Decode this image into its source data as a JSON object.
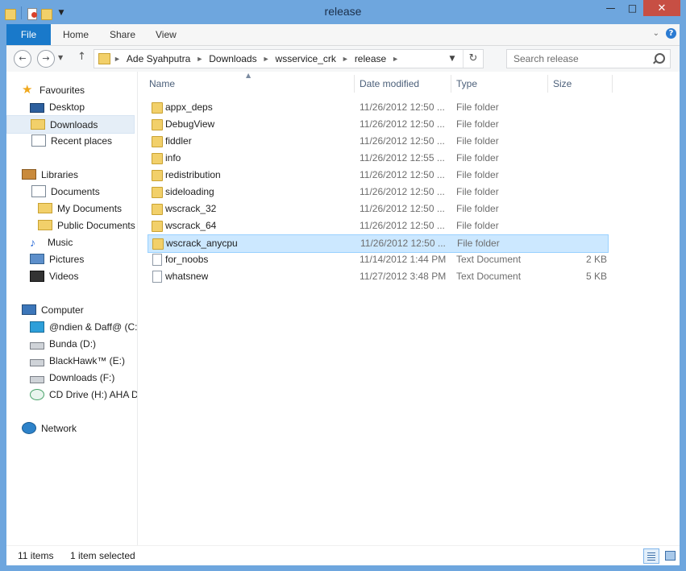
{
  "window": {
    "title": "release",
    "minimize": "—",
    "maximize": "□",
    "close": "✕"
  },
  "ribbon": {
    "tabs": [
      "File",
      "Home",
      "Share",
      "View"
    ]
  },
  "address": {
    "crumbs": [
      "Ade Syahputra",
      "Downloads",
      "wsservice_crk",
      "release"
    ]
  },
  "search": {
    "placeholder": "Search release"
  },
  "columns": {
    "name": "Name",
    "date": "Date modified",
    "type": "Type",
    "size": "Size"
  },
  "nav": [
    {
      "label": "Favourites",
      "icon": "star-icon",
      "indent": 0,
      "group": true
    },
    {
      "label": "Desktop",
      "icon": "desktop-icon",
      "indent": 1
    },
    {
      "label": "Downloads",
      "icon": "downloads-folder-icon",
      "indent": 1,
      "selected": true
    },
    {
      "label": "Recent places",
      "icon": "recent-places-icon",
      "indent": 1
    },
    {
      "label": "Libraries",
      "icon": "libraries-icon",
      "indent": 0,
      "group": true
    },
    {
      "label": "Documents",
      "icon": "documents-icon",
      "indent": 1
    },
    {
      "label": "My Documents",
      "icon": "folder-icon",
      "indent": 2
    },
    {
      "label": "Public Documents",
      "icon": "folder-icon",
      "indent": 2
    },
    {
      "label": "Music",
      "icon": "music-icon",
      "indent": 1
    },
    {
      "label": "Pictures",
      "icon": "pictures-icon",
      "indent": 1
    },
    {
      "label": "Videos",
      "icon": "videos-icon",
      "indent": 1
    },
    {
      "label": "Computer",
      "icon": "computer-icon",
      "indent": 0,
      "group": true
    },
    {
      "label": "@ndien & Daff@ (C:",
      "icon": "windows-drive-icon",
      "indent": 1
    },
    {
      "label": "Bunda (D:)",
      "icon": "drive-icon",
      "indent": 1
    },
    {
      "label": "BlackHawk™ (E:)",
      "icon": "drive-icon",
      "indent": 1
    },
    {
      "label": "Downloads (F:)",
      "icon": "drive-icon",
      "indent": 1
    },
    {
      "label": "CD Drive (H:) AHA D",
      "icon": "cd-drive-icon",
      "indent": 1
    },
    {
      "label": "Network",
      "icon": "network-icon",
      "indent": 0,
      "group": true
    }
  ],
  "files": [
    {
      "name": "appx_deps",
      "date": "11/26/2012 12:50 ...",
      "type": "File folder",
      "size": "",
      "kind": "folder"
    },
    {
      "name": "DebugView",
      "date": "11/26/2012 12:50 ...",
      "type": "File folder",
      "size": "",
      "kind": "folder"
    },
    {
      "name": "fiddler",
      "date": "11/26/2012 12:50 ...",
      "type": "File folder",
      "size": "",
      "kind": "folder"
    },
    {
      "name": "info",
      "date": "11/26/2012 12:55 ...",
      "type": "File folder",
      "size": "",
      "kind": "folder"
    },
    {
      "name": "redistribution",
      "date": "11/26/2012 12:50 ...",
      "type": "File folder",
      "size": "",
      "kind": "folder"
    },
    {
      "name": "sideloading",
      "date": "11/26/2012 12:50 ...",
      "type": "File folder",
      "size": "",
      "kind": "folder"
    },
    {
      "name": "wscrack_32",
      "date": "11/26/2012 12:50 ...",
      "type": "File folder",
      "size": "",
      "kind": "folder"
    },
    {
      "name": "wscrack_64",
      "date": "11/26/2012 12:50 ...",
      "type": "File folder",
      "size": "",
      "kind": "folder"
    },
    {
      "name": "wscrack_anycpu",
      "date": "11/26/2012 12:50 ...",
      "type": "File folder",
      "size": "",
      "kind": "folder",
      "selected": true
    },
    {
      "name": "for_noobs",
      "date": "11/14/2012 1:44 PM",
      "type": "Text Document",
      "size": "2 KB",
      "kind": "text"
    },
    {
      "name": "whatsnew",
      "date": "11/27/2012 3:48 PM",
      "type": "Text Document",
      "size": "5 KB",
      "kind": "text"
    }
  ],
  "status": {
    "count": "11 items",
    "selection": "1 item selected"
  }
}
